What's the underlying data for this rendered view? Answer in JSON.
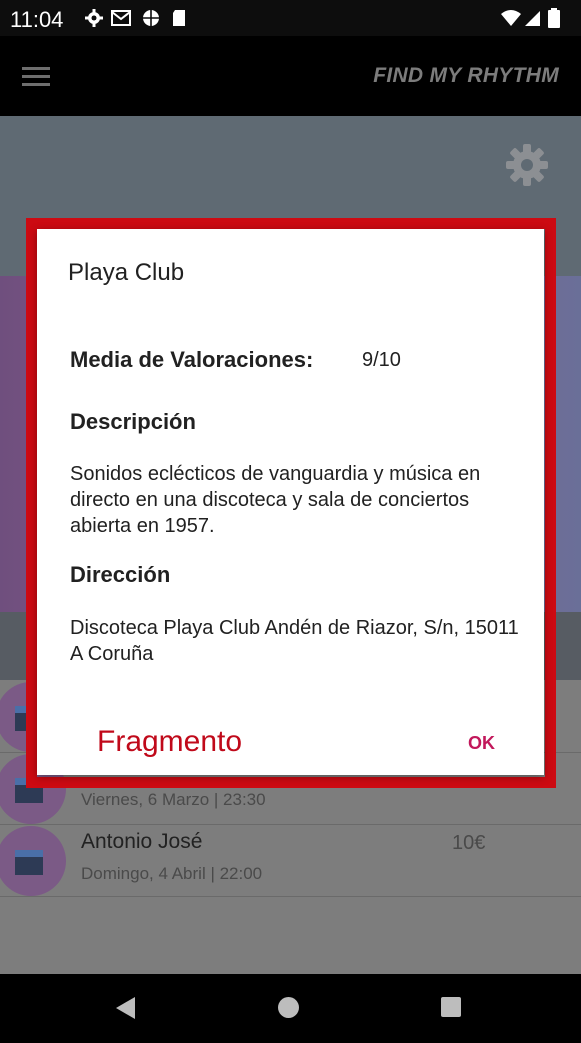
{
  "status_bar": {
    "time": "11:04"
  },
  "app_bar": {
    "title": "FIND MY RHYTHM",
    "menu_icon": "hamburger-menu-icon"
  },
  "settings": {
    "icon": "gear-icon"
  },
  "list": {
    "items": [
      {
        "title": "",
        "subtitle": "",
        "price": ""
      },
      {
        "title": "",
        "subtitle": "Viernes, 6 Marzo | 23:30",
        "price": ""
      },
      {
        "title": "Antonio José",
        "subtitle": "Domingo, 4 Abril | 22:00",
        "price": "10€"
      }
    ]
  },
  "dialog": {
    "title": "Playa Club",
    "rating_label": "Media de Valoraciones:",
    "rating_value": "9/10",
    "description_label": "Descripción",
    "description_text": "Sonidos eclécticos de vanguardia y música en directo en una discoteca y sala de conciertos abierta en 1957.",
    "address_label": "Dirección",
    "address_text": "Discoteca Playa Club Andén de Riazor, S/n, 15011 A Coruña",
    "ok_label": "OK"
  },
  "annotation": {
    "label": "Fragmento",
    "color": "#cc0a12"
  },
  "colors": {
    "accent": "#c2185b",
    "annotation_red": "#cc0a12",
    "avatar": "#7b5a86"
  }
}
